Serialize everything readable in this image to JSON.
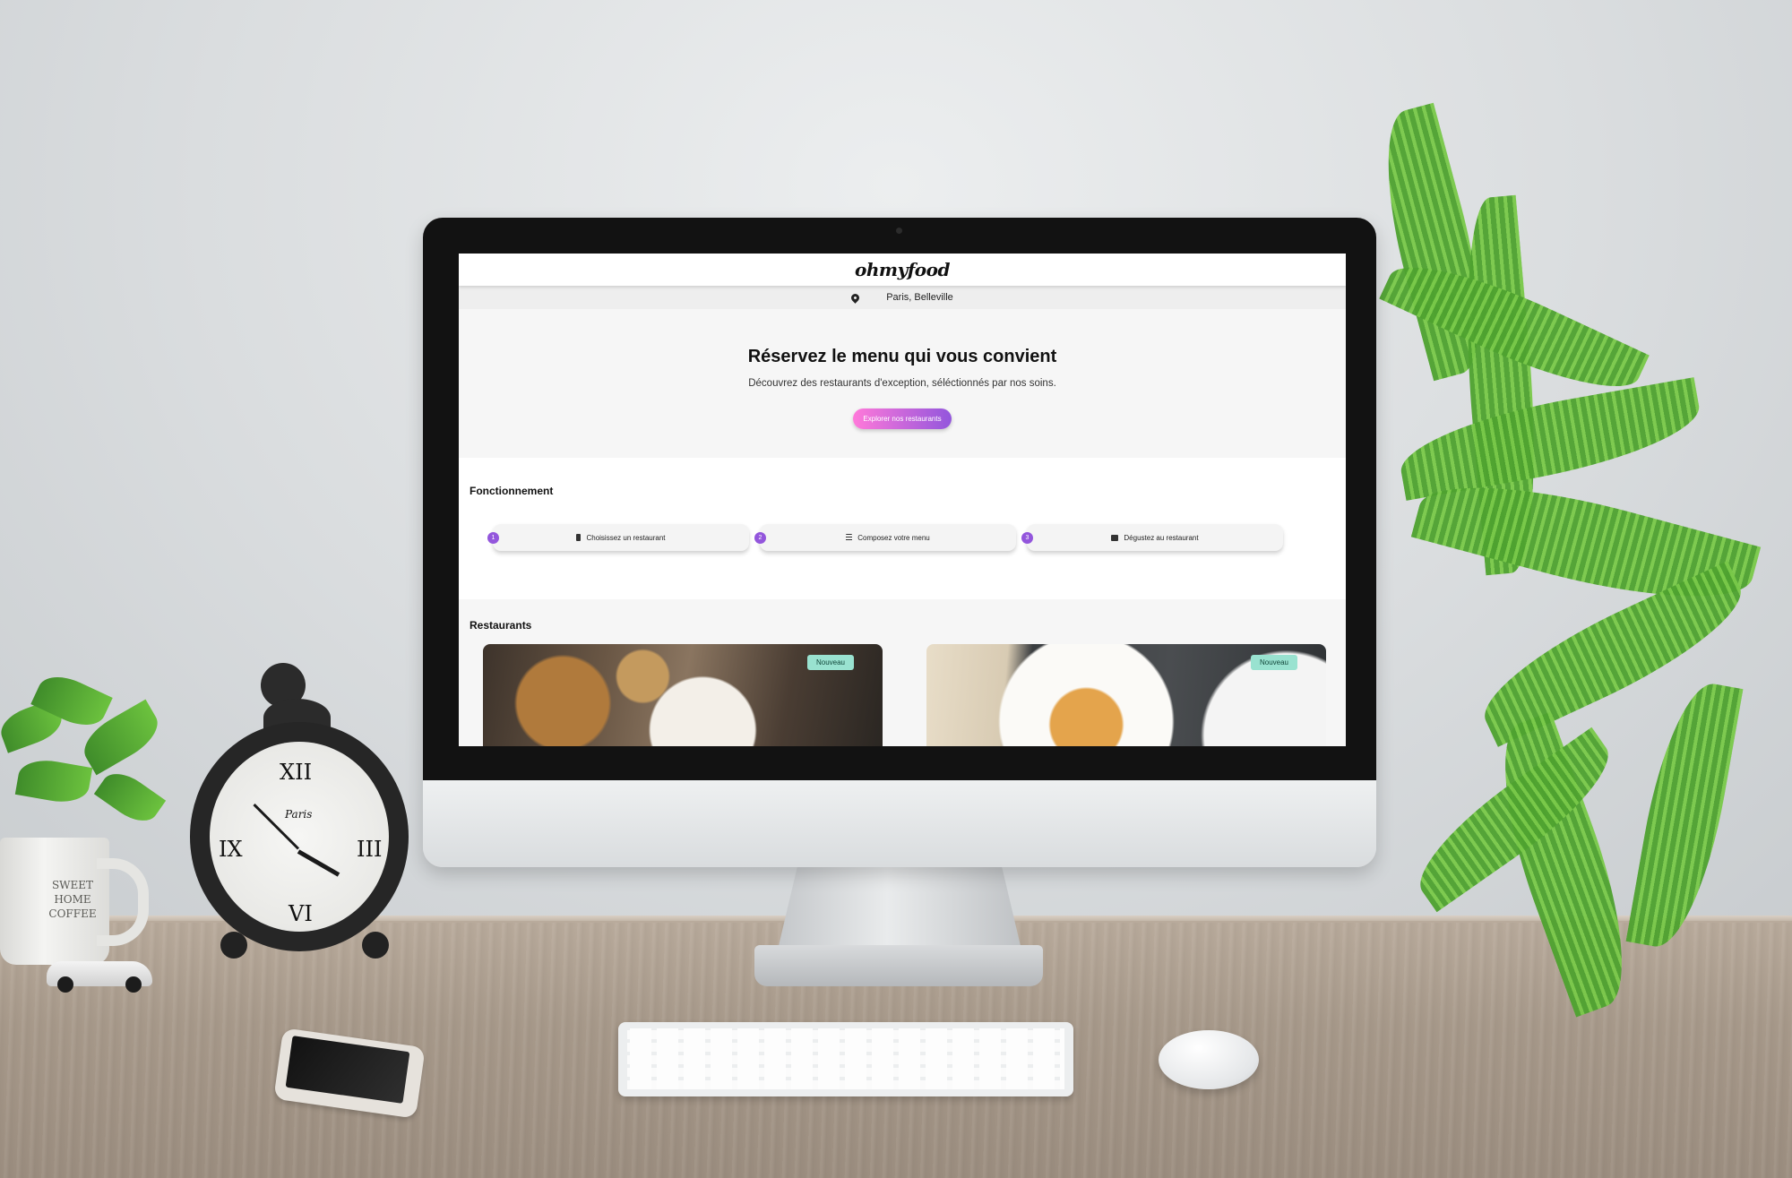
{
  "site": {
    "logo": "ohmyfood",
    "location": "Paris, Belleville"
  },
  "hero": {
    "title": "Réservez le menu qui vous convient",
    "subtitle": "Découvrez des restaurants d'exception, séléctionnés par nos soins.",
    "cta_label": "Explorer nos restaurants"
  },
  "how_it_works": {
    "title": "Fonctionnement",
    "steps": [
      {
        "number": "1",
        "icon": "smartphone-icon",
        "label": "Choisissez un restaurant"
      },
      {
        "number": "2",
        "icon": "list-icon",
        "label": "Composez votre menu"
      },
      {
        "number": "3",
        "icon": "store-icon",
        "label": "Dégustez au restaurant"
      }
    ]
  },
  "restaurants": {
    "title": "Restaurants",
    "cards": [
      {
        "badge": "Nouveau"
      },
      {
        "badge": "Nouveau"
      }
    ]
  },
  "decor": {
    "mug_text": "SWEET HOME COFFEE",
    "clock_brand": "Paris",
    "clock_numerals": [
      "XII",
      "III",
      "VI",
      "IX"
    ]
  },
  "colors": {
    "accent_gradient_start": "#ff79da",
    "accent_gradient_end": "#9356dc",
    "badge_bg": "#99e2d0",
    "step_number_bg": "#9356dc"
  }
}
